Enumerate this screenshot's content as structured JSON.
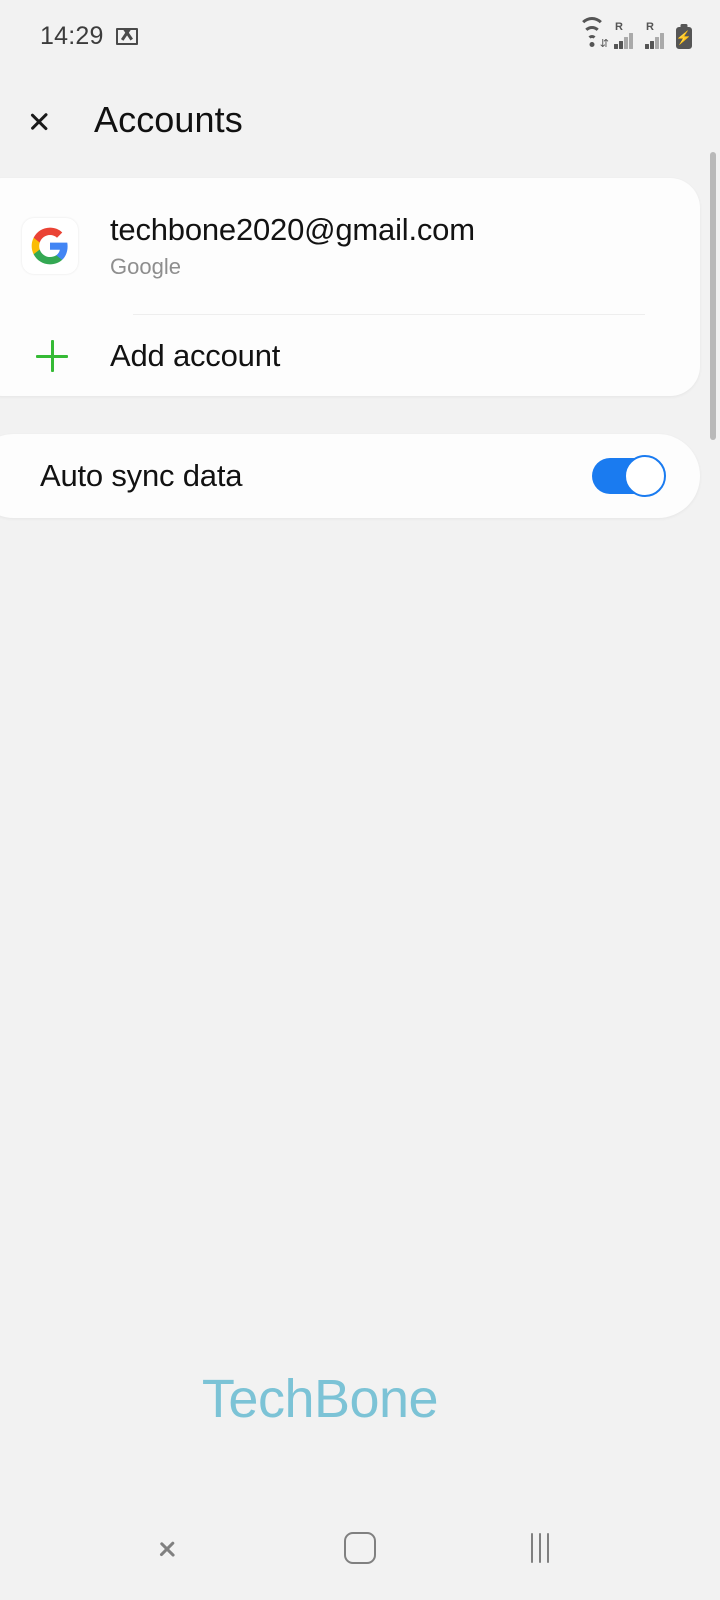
{
  "status_bar": {
    "time": "14:29",
    "notification_icon": "gmail-icon",
    "wifi_icon": "wifi-icon",
    "wifi_transfer_glyph": "⇵",
    "sim1_roaming_label": "R",
    "sim2_roaming_label": "R",
    "battery_icon": "battery-charging-icon",
    "battery_bolt_glyph": "⚡"
  },
  "header": {
    "back_icon": "back-chevron-icon",
    "title": "Accounts"
  },
  "accounts_card": {
    "account": {
      "icon": "google-logo-icon",
      "email": "techbone2020@gmail.com",
      "provider": "Google"
    },
    "add_account": {
      "icon": "plus-icon",
      "label": "Add account"
    }
  },
  "auto_sync_card": {
    "label": "Auto sync data",
    "toggle_state": "on"
  },
  "watermark": {
    "text": "TechBone"
  },
  "navigation_bar": {
    "back_label": "Back",
    "home_label": "Home",
    "recents_label": "Recents"
  },
  "colors": {
    "background": "#f2f2f2",
    "card": "#fdfdfd",
    "toggle_on": "#1a7bf0",
    "plus_green": "#35ba35",
    "watermark": "#7cc3d6",
    "primary_text": "#121212",
    "secondary_text": "#8e8e8e",
    "nav_icon": "#808080"
  }
}
